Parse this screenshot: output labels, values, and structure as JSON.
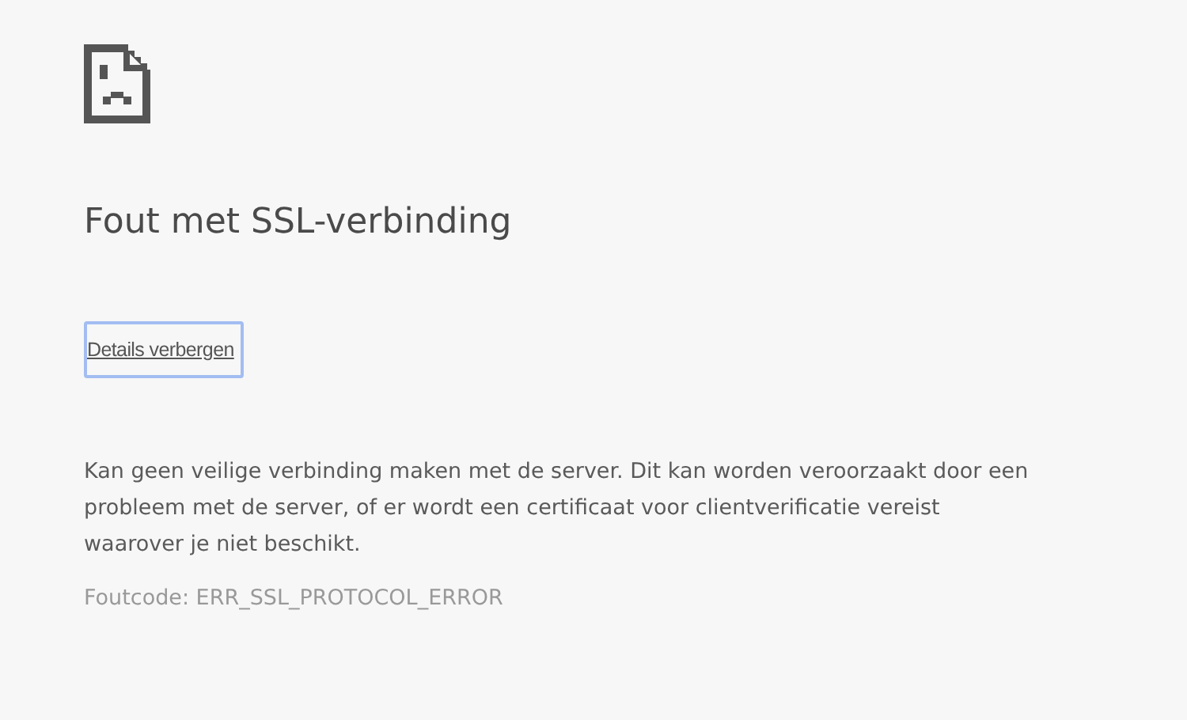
{
  "title": "Fout met SSL-verbinding",
  "details_button": {
    "label": "Details verbergen",
    "focused": true
  },
  "details": "Kan geen veilige verbinding maken met de server. Dit kan worden veroorzaakt door een probleem met de server, of er wordt een certificaat voor clientverificatie vereist waarover je niet beschikt.",
  "error_code": "Foutcode: ERR_SSL_PROTOCOL_ERROR"
}
